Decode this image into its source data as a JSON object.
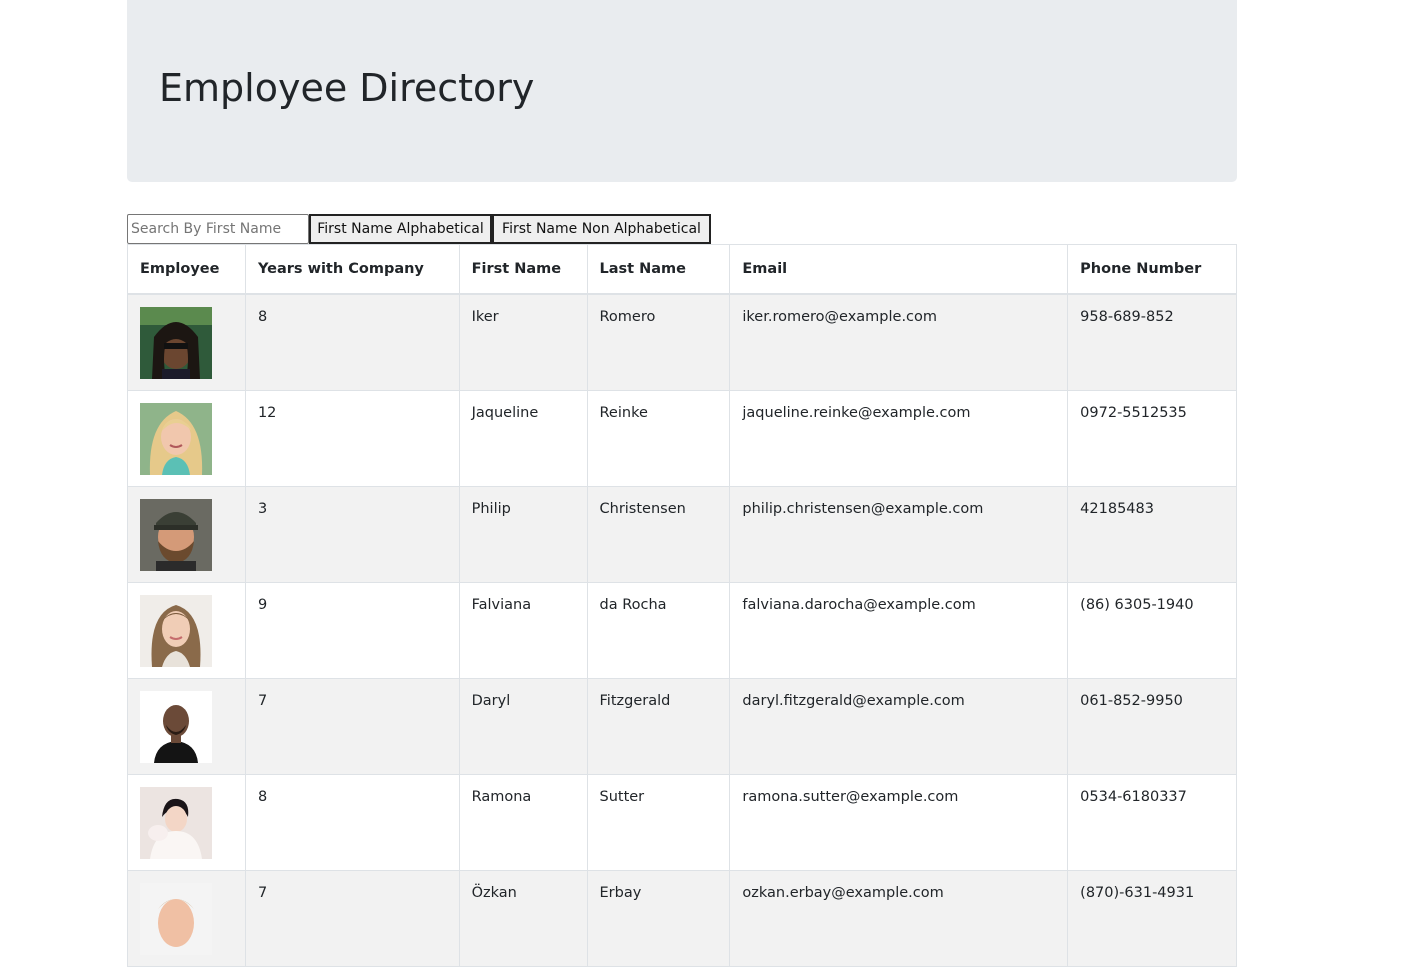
{
  "header": {
    "title": "Employee Directory"
  },
  "controls": {
    "search_placeholder": "Search By First Name",
    "sort_asc_label": "First Name Alphabetical",
    "sort_desc_label": "First Name Non Alphabetical"
  },
  "table": {
    "columns": [
      "Employee",
      "Years with Company",
      "First Name",
      "Last Name",
      "Email",
      "Phone Number"
    ],
    "rows": [
      {
        "years": "8",
        "first": "Iker",
        "last": "Romero",
        "email": "iker.romero@example.com",
        "phone": "958-689-852",
        "avatar_icon": "employee-photo-icon"
      },
      {
        "years": "12",
        "first": "Jaqueline",
        "last": "Reinke",
        "email": "jaqueline.reinke@example.com",
        "phone": "0972-5512535",
        "avatar_icon": "employee-photo-icon"
      },
      {
        "years": "3",
        "first": "Philip",
        "last": "Christensen",
        "email": "philip.christensen@example.com",
        "phone": "42185483",
        "avatar_icon": "employee-photo-icon"
      },
      {
        "years": "9",
        "first": "Falviana",
        "last": "da Rocha",
        "email": "falviana.darocha@example.com",
        "phone": "(86) 6305-1940",
        "avatar_icon": "employee-photo-icon"
      },
      {
        "years": "7",
        "first": "Daryl",
        "last": "Fitzgerald",
        "email": "daryl.fitzgerald@example.com",
        "phone": "061-852-9950",
        "avatar_icon": "employee-photo-icon"
      },
      {
        "years": "8",
        "first": "Ramona",
        "last": "Sutter",
        "email": "ramona.sutter@example.com",
        "phone": "0534-6180337",
        "avatar_icon": "employee-photo-icon"
      },
      {
        "years": "7",
        "first": "Özkan",
        "last": "Erbay",
        "email": "ozkan.erbay@example.com",
        "phone": "(870)-631-4931",
        "avatar_icon": "employee-photo-icon"
      }
    ]
  },
  "colors": {
    "header_bg": "#e9ecef",
    "stripe_bg": "#f2f2f2",
    "border": "#dee2e6",
    "text": "#212529"
  }
}
